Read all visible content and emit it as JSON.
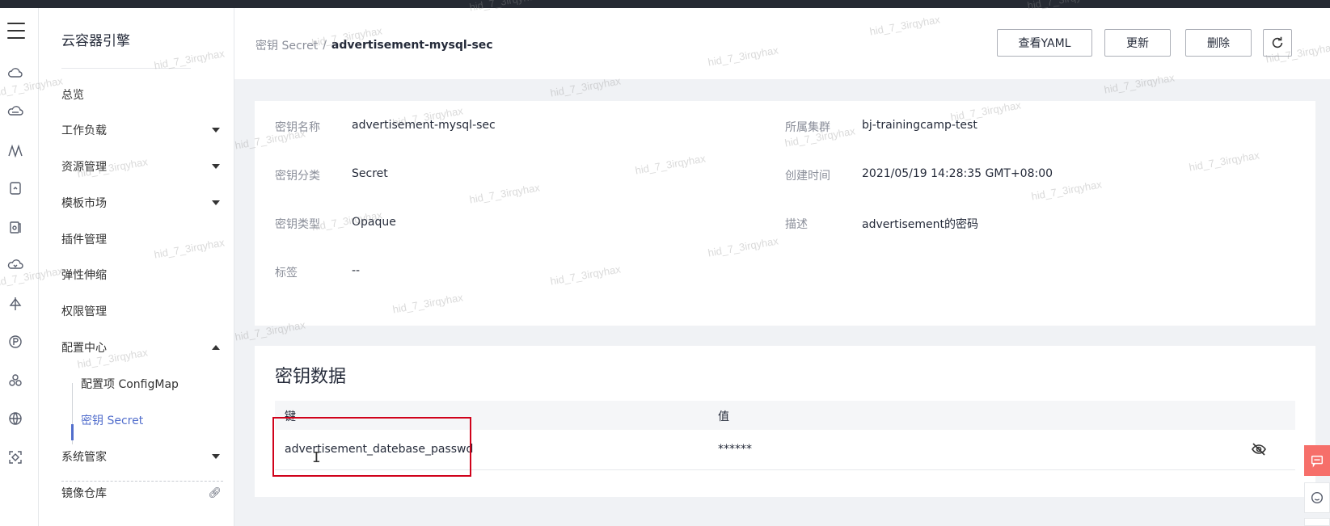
{
  "sidebar": {
    "brand": "云容器引擎",
    "items": [
      {
        "label": "总览"
      },
      {
        "label": "工作负载"
      },
      {
        "label": "资源管理"
      },
      {
        "label": "模板市场"
      },
      {
        "label": "插件管理"
      },
      {
        "label": "弹性伸缩"
      },
      {
        "label": "权限管理"
      },
      {
        "label": "配置中心"
      },
      {
        "label": "系统管家"
      },
      {
        "label": "镜像仓库"
      }
    ],
    "subitems": [
      {
        "label": "配置项 ConfigMap"
      },
      {
        "label": "密钥 Secret"
      }
    ]
  },
  "breadcrumb": {
    "parent": "密钥 Secret",
    "separator": "/",
    "current": "advertisement-mysql-sec"
  },
  "toolbar": {
    "view_yaml": "查看YAML",
    "update": "更新",
    "delete": "删除"
  },
  "details": {
    "name_label": "密钥名称",
    "name_value": "advertisement-mysql-sec",
    "cluster_label": "所属集群",
    "cluster_value": "bj-trainingcamp-test",
    "category_label": "密钥分类",
    "category_value": "Secret",
    "created_label": "创建时间",
    "created_value": "2021/05/19 14:28:35 GMT+08:00",
    "type_label": "密钥类型",
    "type_value": "Opaque",
    "desc_label": "描述",
    "desc_value": "advertisement的密码",
    "tags_label": "标签",
    "tags_value": "--"
  },
  "secret_data": {
    "title": "密钥数据",
    "col_key": "键",
    "col_value": "值",
    "rows": [
      {
        "key": "advertisement_datebase_passwd",
        "value": "******"
      }
    ]
  },
  "watermark": "hid_7_3irqyhax",
  "colors": {
    "accent": "#526ecc",
    "highlight_box": "#d0021b",
    "float_button": "#f66f6a"
  }
}
